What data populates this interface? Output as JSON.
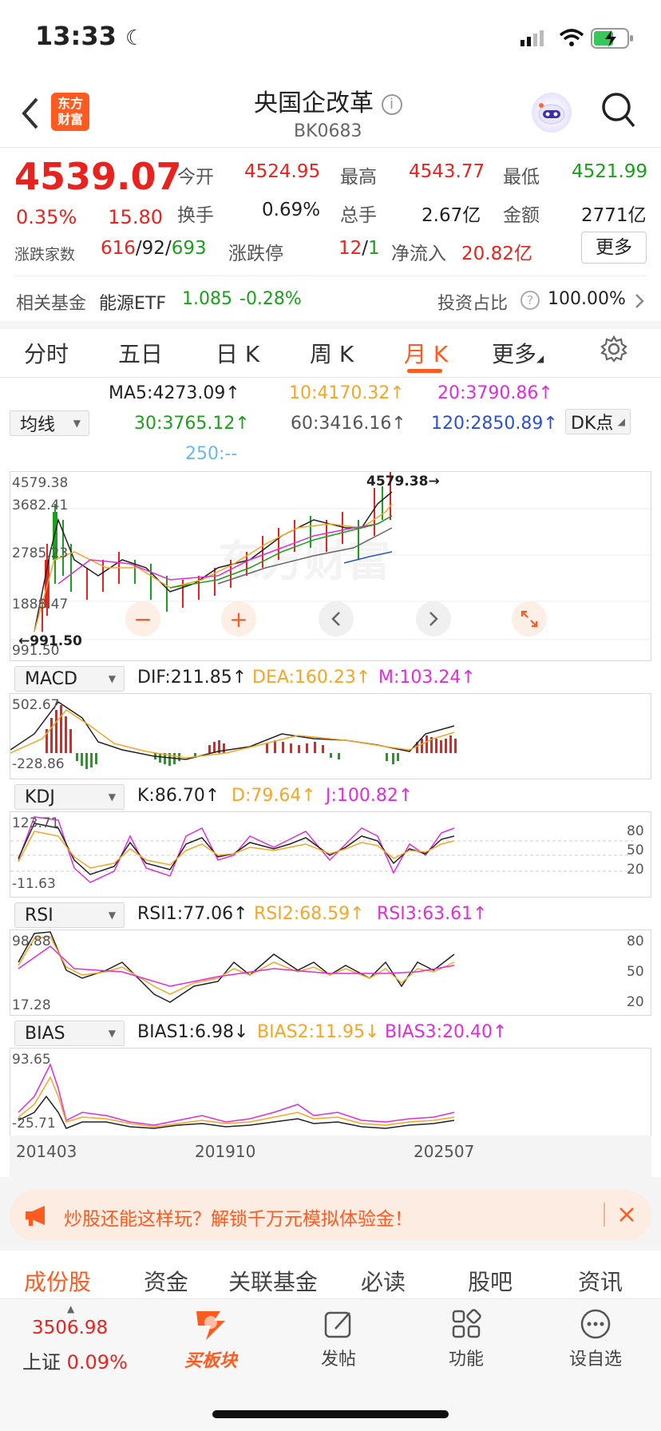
{
  "status_bar": {
    "time": "13:33"
  },
  "header": {
    "logo_line1": "东方",
    "logo_line2": "财富",
    "title": "央国企改革",
    "code": "BK0683"
  },
  "quote": {
    "price": "4539.07",
    "change_pct": "0.35%",
    "change": "15.80",
    "open_label": "今开",
    "open": "4524.95",
    "high_label": "最高",
    "high": "4543.77",
    "low_label": "最低",
    "low": "4521.99",
    "turnover_label": "换手",
    "turnover": "0.69%",
    "volume_label": "总手",
    "volume": "2.67亿",
    "amount_label": "金额",
    "amount": "2771亿",
    "breadth_label": "涨跌家数",
    "up": "616",
    "flat": "92",
    "down": "693",
    "limit_label": "涨跌停",
    "limit_up": "12",
    "limit_down": "1",
    "inflow_label": "净流入",
    "inflow": "20.82亿",
    "more_button": "更多"
  },
  "fund_row": {
    "label": "相关基金",
    "fund_name": "能源ETF",
    "fund_price": "1.085",
    "fund_change": "-0.28%",
    "ratio_label": "投资占比",
    "ratio": "100.00%"
  },
  "period_tabs": [
    "分时",
    "五日",
    "日 K",
    "周 K",
    "月 K",
    "更多"
  ],
  "active_tab": "月 K",
  "ma": {
    "selector": "均线",
    "ma5": "MA5:4273.09",
    "ma10": "10:4170.32",
    "ma20": "20:3790.86",
    "ma30": "30:3765.12",
    "ma60": "60:3416.16",
    "ma120": "120:2850.89",
    "ma250": "250:--",
    "dk_button": "DK点"
  },
  "main_chart": {
    "y_labels": [
      "4579.38",
      "3682.41",
      "2785.23",
      "1888.47",
      "991.50"
    ],
    "max_marker": "4579.38",
    "min_marker": "991.50",
    "watermark": "东方财富"
  },
  "macd": {
    "selector": "MACD",
    "dif": "DIF:211.85",
    "dea": "DEA:160.23",
    "m": "M:103.24",
    "top": "502.67",
    "bottom": "-228.86"
  },
  "kdj": {
    "selector": "KDJ",
    "k": "K:86.70",
    "d": "D:79.64",
    "j": "J:100.82",
    "top": "123.71",
    "bottom": "-11.63",
    "levels": [
      "80",
      "50",
      "20"
    ]
  },
  "rsi": {
    "selector": "RSI",
    "rsi1": "RSI1:77.06",
    "rsi2": "RSI2:68.59",
    "rsi3": "RSI3:63.61",
    "top": "98.88",
    "bottom": "17.28",
    "levels": [
      "80",
      "50",
      "20"
    ]
  },
  "bias": {
    "selector": "BIAS",
    "bias1": "BIAS1:6.98",
    "bias2": "BIAS2:11.95",
    "bias3": "BIAS3:20.40",
    "top": "93.65",
    "bottom": "-25.71"
  },
  "x_labels": [
    "201403",
    "201910",
    "202507"
  ],
  "promo": {
    "text": "炒股还能这样玩？解锁千万元模拟体验金！"
  },
  "bottom_tabs": [
    "成份股",
    "资金",
    "关联基金",
    "必读",
    "股吧",
    "资讯"
  ],
  "active_bottom_tab": "成份股",
  "index_ticker": {
    "value": "3506.98",
    "name": "上证",
    "change": "0.09%"
  },
  "nav": {
    "buy": "买板块",
    "post": "发帖",
    "func": "功能",
    "watch": "设自选"
  },
  "colors": {
    "up": "#e8231f",
    "down": "#1aa01a",
    "accent": "#ff5a1f"
  }
}
